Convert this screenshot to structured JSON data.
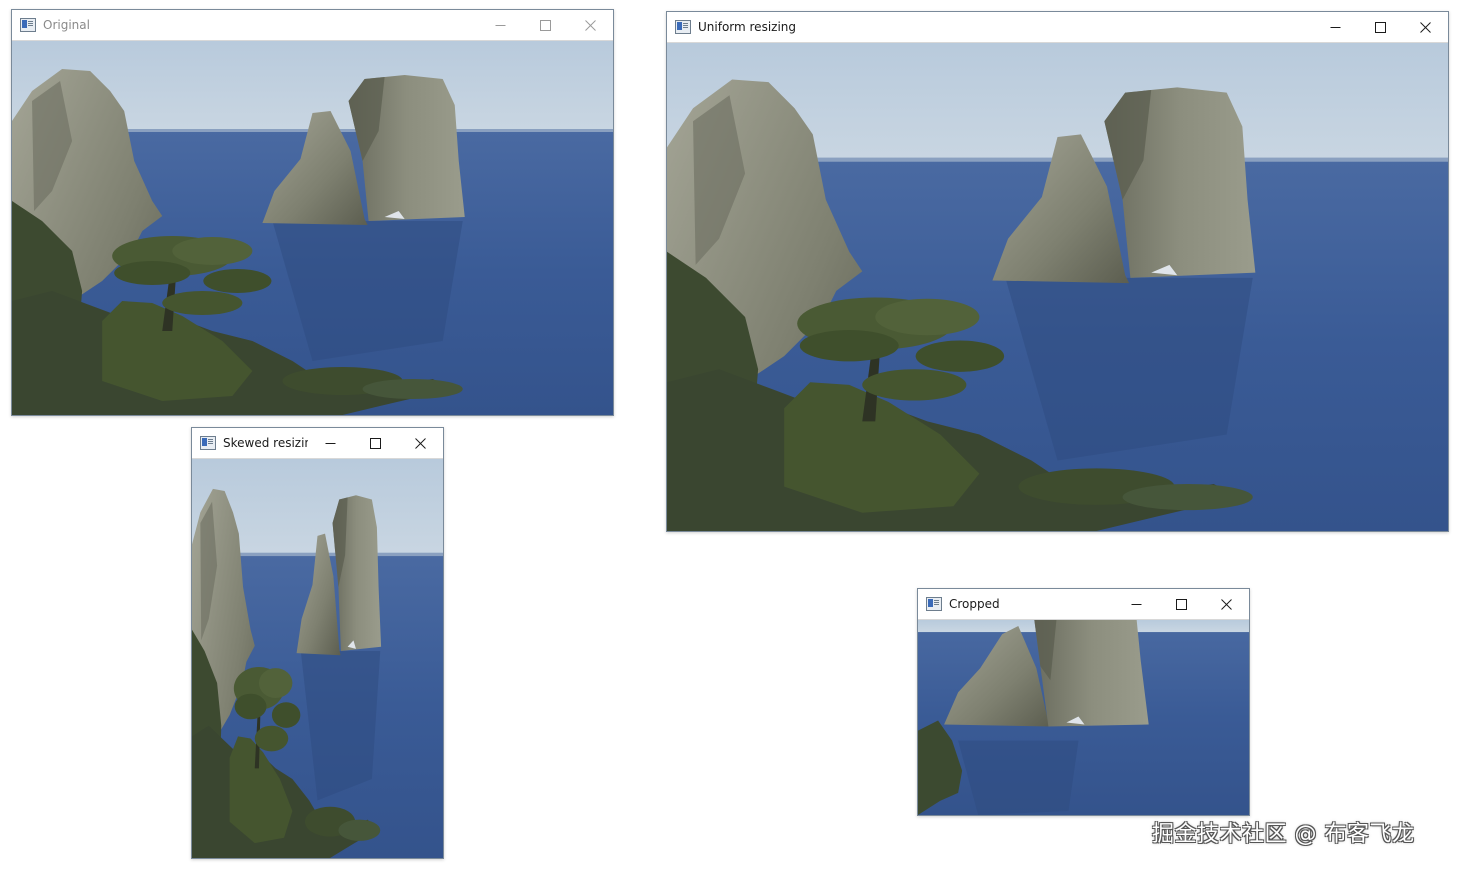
{
  "windows": {
    "original": {
      "title": "Original"
    },
    "uniform": {
      "title": "Uniform resizing"
    },
    "skewed": {
      "title": "Skewed resizing"
    },
    "cropped": {
      "title": "Cropped"
    }
  },
  "icons": {
    "app": "opencv-window-icon",
    "minimize": "minimize-icon",
    "maximize": "maximize-icon",
    "close": "close-icon"
  },
  "image": {
    "subject": "sea-stacks-coastline-photo",
    "colors": {
      "sky": "#b5c7da",
      "sea": "#3b5a94",
      "rock": "#8a8c7c",
      "foliage": "#3c4a30"
    }
  },
  "watermark": {
    "text": "掘金技术社区 @ 布客飞龙"
  }
}
